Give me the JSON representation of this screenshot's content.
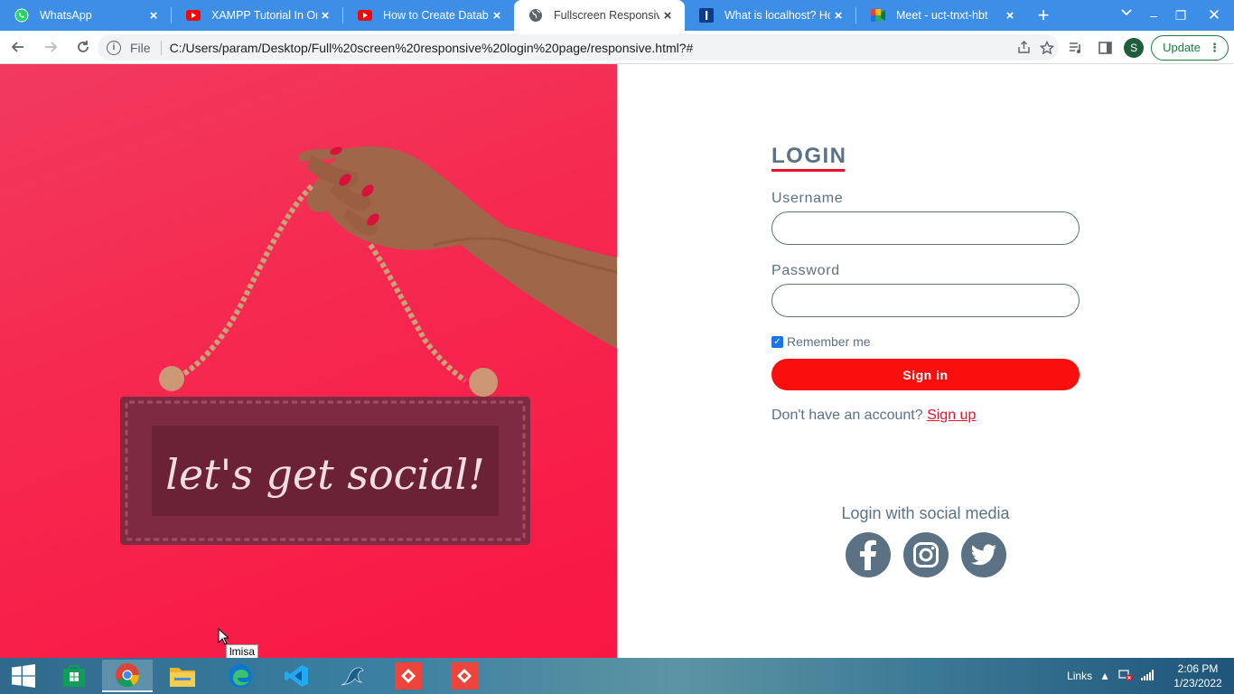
{
  "tabs": [
    {
      "title": "WhatsApp",
      "icon": "whatsapp-icon"
    },
    {
      "title": "XAMPP Tutorial In One",
      "icon": "youtube-icon"
    },
    {
      "title": "How to Create Databas",
      "icon": "youtube-icon"
    },
    {
      "title": "Fullscreen Responsive L",
      "icon": "globe-icon",
      "active": true
    },
    {
      "title": "What is localhost? How",
      "icon": "site-i-icon"
    },
    {
      "title": "Meet - uct-tnxt-hbt",
      "icon": "google-meet-icon"
    }
  ],
  "toolbar": {
    "scheme": "File",
    "url": "C:/Users/param/Desktop/Full%20screen%20responsive%20login%20page/responsive.html?#",
    "profile_initial": "S",
    "update_label": "Update"
  },
  "hero": {
    "sign_text": "let's get social!"
  },
  "login": {
    "title": "LOGIN",
    "username_label": "Username",
    "username_value": "",
    "password_label": "Password",
    "password_value": "",
    "remember_label": "Remember me",
    "remember_checked": true,
    "signin_label": "Sign in",
    "no_account_text": "Don't have an account?",
    "signup_label": "Sign up",
    "social_title": "Login with social media",
    "social_icons": [
      "facebook-icon",
      "instagram-icon",
      "twitter-icon"
    ]
  },
  "tooltip": "lmisa",
  "taskbar": {
    "apps": [
      "windows-store-icon",
      "chrome-icon",
      "file-explorer-icon",
      "edge-icon",
      "vscode-icon",
      "mysql-workbench-icon",
      "anydesk-icon",
      "anydesk-icon"
    ],
    "links_label": "Links",
    "time": "2:06 PM",
    "date": "1/23/2022"
  },
  "colors": {
    "tab_strip": "#3c8ee6",
    "accent_red": "#e8102c",
    "signin_button": "#fa0f0f",
    "text_slate": "#5b7285",
    "hero_pink": "#f6284f"
  }
}
